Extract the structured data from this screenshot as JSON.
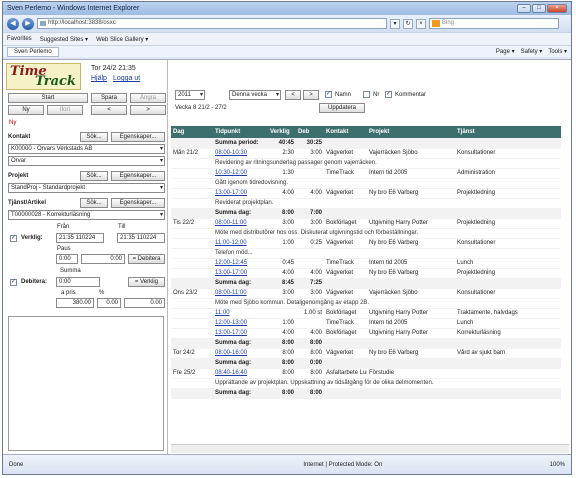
{
  "window": {
    "title": "Sven Perlemo - Windows Internet Explorer",
    "url": "http://localhost:3838/osxc",
    "search_placeholder": "Bing"
  },
  "favbar": {
    "favorites": "Favorites",
    "suggested": "Suggested Sites ▾",
    "webslice": "Web Slice Gallery ▾"
  },
  "tab": {
    "label": "Sven Perlemo",
    "cmds": [
      "Page ▾",
      "Safety ▾",
      "Tools ▾"
    ]
  },
  "app": {
    "logo1": "Time",
    "logo2": "Track",
    "datetime": "Tor 24/2 21:35",
    "help": "Hjälp",
    "logout": "Logga ut",
    "start": "Start",
    "save": "Spara",
    "undo": "Ångra",
    "new_btn": "Ny",
    "delete": "Ifort",
    "prev": "<",
    "next": ">",
    "new_label": "Ny",
    "contact_label": "Kontakt",
    "search": "Sök...",
    "props": "Egenskaper...",
    "contact_value": "K00000 - Orvars Verkstads AB",
    "person_value": "Orvar",
    "project_label": "Projekt",
    "project_value": "StandProj - Standardprojekt",
    "service_label": "Tjänst/Artikel",
    "service_value": "T00000028 - Korrekturläsning",
    "actual_label": "Verklig:",
    "from_label": "Från",
    "to_label": "Till",
    "from_value": "21:35  110224",
    "to_value": "21:35  110224",
    "pause_label": "Paus",
    "pause_value": "0:00",
    "actual_total": "0:00",
    "debit_btn": "= Debitera",
    "debit_label": "Debitera:",
    "sum_label": "Summa",
    "sum_value": "0:00",
    "to_actual_btn": "= Verklig",
    "price_label": "a pris",
    "pct_label": "%",
    "price_value": "380.00",
    "pct_value": "0.00",
    "amount_value": "0.00"
  },
  "filter": {
    "year": "2011",
    "period": "Denna vecka",
    "week_label": "Vecka 8 21/2 - 27/2",
    "refresh": "Uppdatera",
    "opt_name": "Namn",
    "opt_nr": "Nr",
    "opt_comment": "Kommentar"
  },
  "table": {
    "headers": [
      "Dag",
      "Tidpunkt",
      "Verklig",
      "Deb",
      "Kontakt",
      "Projekt",
      "Tjänst"
    ],
    "period_sum": "Summa period:",
    "period_actual": "40:45",
    "period_deb": "30:25",
    "rows": [
      {
        "kind": "row",
        "day": "Mån 21/2",
        "time": "08:00-10:30",
        "act": "2:30",
        "deb": "3:00",
        "contact": "Vägverket",
        "project": "Vajerräcken Sjöbo",
        "service": "Konsultationer"
      },
      {
        "kind": "desc",
        "text": "Revidering av ritningsunderlag passager genom vajerräcken."
      },
      {
        "kind": "row",
        "day": "",
        "time": "10:30-12:00",
        "act": "1:30",
        "deb": "",
        "contact": "TimeTrack",
        "project": "Intern tid 2005",
        "service": "Administration"
      },
      {
        "kind": "desc",
        "text": "Gått igenom tidredovisning."
      },
      {
        "kind": "row",
        "day": "",
        "time": "13:00-17:00",
        "act": "4:00",
        "deb": "4:00",
        "contact": "Vägverket",
        "project": "Ny bro E6 Varberg",
        "service": "Projektledning"
      },
      {
        "kind": "desc",
        "text": "Reviderat projektplan."
      },
      {
        "kind": "sum",
        "label": "Summa dag:",
        "act": "8:00",
        "deb": "7:00"
      },
      {
        "kind": "row",
        "day": "Tis 22/2",
        "time": "08:00-11:00",
        "act": "3:00",
        "deb": "3:00",
        "contact": "Bokförlaget",
        "project": "Utgivning Harry Potter",
        "service": "Projektledning"
      },
      {
        "kind": "desc",
        "text": "Möte med distributörer hos oss. Diskuterat utgivningstid och förbeställningar."
      },
      {
        "kind": "row",
        "day": "",
        "time": "11:00-12:00",
        "act": "1:00",
        "deb": "0:25",
        "contact": "Vägverket",
        "project": "Ny bro E6 Varberg",
        "service": "Konsultationer"
      },
      {
        "kind": "desc",
        "text": "Telefon möd..."
      },
      {
        "kind": "row",
        "day": "",
        "time": "12:00-12:45",
        "act": "0:45",
        "deb": "",
        "contact": "TimeTrack",
        "project": "Intern tid 2005",
        "service": "Lunch"
      },
      {
        "kind": "row",
        "day": "",
        "time": "13:00-17:00",
        "act": "4:00",
        "deb": "4:00",
        "contact": "Vägverket",
        "project": "Ny bro E6 Varberg",
        "service": "Projektledning"
      },
      {
        "kind": "sum",
        "label": "Summa dag:",
        "act": "8:45",
        "deb": "7:25"
      },
      {
        "kind": "row",
        "day": "Ons 23/2",
        "time": "08:00-11:00",
        "act": "3:00",
        "deb": "3:00",
        "contact": "Vägverket",
        "project": "Vajerräcken Sjöbo",
        "service": "Konsultationer"
      },
      {
        "kind": "desc",
        "text": "Möte med Sjöbo kommun. Detaljgenomgång av etapp 2B."
      },
      {
        "kind": "row",
        "day": "",
        "time": "11:00",
        "act": "",
        "deb": "1.00 st",
        "contact": "Bokförlaget",
        "project": "Utgivning Harry Potter",
        "service": "Traktamente, halvdags"
      },
      {
        "kind": "row",
        "day": "",
        "time": "12:00-13:00",
        "act": "1:00",
        "deb": "",
        "contact": "TimeTrack",
        "project": "Intern tid 2005",
        "service": "Lunch"
      },
      {
        "kind": "row",
        "day": "",
        "time": "13:00-17:00",
        "act": "4:00",
        "deb": "4:00",
        "contact": "Bokförlaget",
        "project": "Utgivning Harry Potter",
        "service": "Korrekturläsning"
      },
      {
        "kind": "sum",
        "label": "Summa dag:",
        "act": "8:00",
        "deb": "8:00"
      },
      {
        "kind": "row",
        "day": "Tor 24/2",
        "time": "08:00-16:00",
        "act": "8:00",
        "deb": "8:00",
        "contact": "Vägverket",
        "project": "Ny bro E6 Varberg",
        "service": "Vård av sjukt barn"
      },
      {
        "kind": "sum",
        "label": "Summa dag:",
        "act": "8:00",
        "deb": "0:00"
      },
      {
        "kind": "row",
        "day": "Fre 25/2",
        "time": "08:40-16:40",
        "act": "8:00",
        "deb": "8:00",
        "contact": "Asfaltarbete Lund-Malmö",
        "project": "Förstudie",
        "service": ""
      },
      {
        "kind": "desc",
        "text": "Upprättande av projektplan. Uppskattning av tidsåtgång för de olika delmomenten."
      },
      {
        "kind": "sum",
        "label": "Summa dag:",
        "act": "8:00",
        "deb": "8:00"
      }
    ]
  },
  "status": {
    "left": "Done",
    "zone": "Internet | Protected Mode: On",
    "zoom": "100%"
  }
}
